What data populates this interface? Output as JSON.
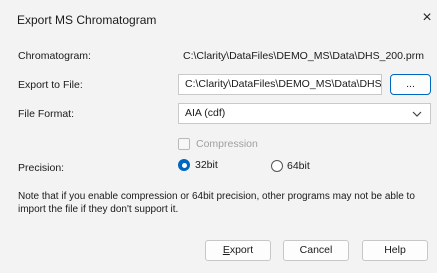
{
  "window": {
    "title": "Export MS Chromatogram",
    "close_glyph": "×"
  },
  "chromatogram": {
    "label": "Chromatogram:",
    "value": "C:\\Clarity\\DataFiles\\DEMO_MS\\Data\\DHS_200.prm"
  },
  "export_file": {
    "label": "Export to File:",
    "value": "C:\\Clarity\\DataFiles\\DEMO_MS\\Data\\DHS_",
    "browse_label": "..."
  },
  "file_format": {
    "label": "File Format:",
    "selected": "AIA (cdf)"
  },
  "compression": {
    "label": "Compression",
    "checked": false,
    "enabled": false
  },
  "precision": {
    "label": "Precision:",
    "options": [
      {
        "label": "32bit",
        "selected": true
      },
      {
        "label": "64bit",
        "selected": false
      }
    ]
  },
  "note": "Note that if you enable compression or 64bit precision, other programs may not be able to import the file if they don't support it.",
  "buttons": {
    "export_first": "E",
    "export_rest": "xport",
    "cancel": "Cancel",
    "help": "Help"
  }
}
